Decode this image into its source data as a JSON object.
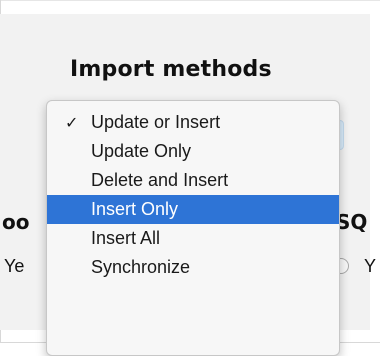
{
  "page": {
    "title": "Import methods",
    "left_column_label": "oo",
    "right_column_label": "SQ",
    "left_radio_label": "Ye",
    "right_radio_label": "Y"
  },
  "menu": {
    "selected_index": 0,
    "highlighted_index": 3,
    "items": [
      {
        "label": "Update or Insert",
        "checked": true
      },
      {
        "label": "Update Only",
        "checked": false
      },
      {
        "label": "Delete and Insert",
        "checked": false
      },
      {
        "label": "Insert Only",
        "checked": false
      },
      {
        "label": "Insert All",
        "checked": false
      },
      {
        "label": "Synchronize",
        "checked": false
      }
    ],
    "check_glyph": "✓"
  },
  "colors": {
    "highlight": "#2e74d6",
    "menu_background": "#f7f7f7",
    "panel_background": "#f2f2f2"
  }
}
